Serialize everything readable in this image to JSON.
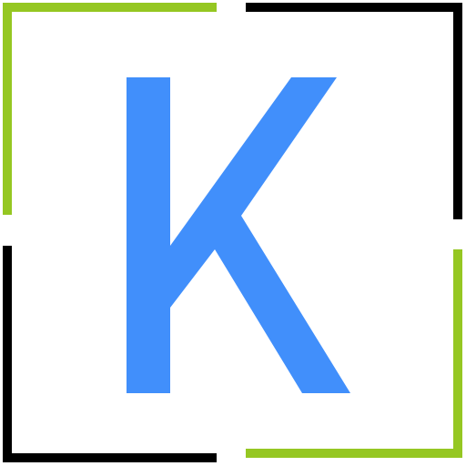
{
  "logo": {
    "letter": "K",
    "colors": {
      "letter": "#418ffb",
      "frame_green": "#95c722",
      "frame_black": "#000000",
      "background": "#ffffff"
    },
    "icons": {
      "letter": "k-letter-icon",
      "frame": "corner-frame-icon"
    }
  }
}
